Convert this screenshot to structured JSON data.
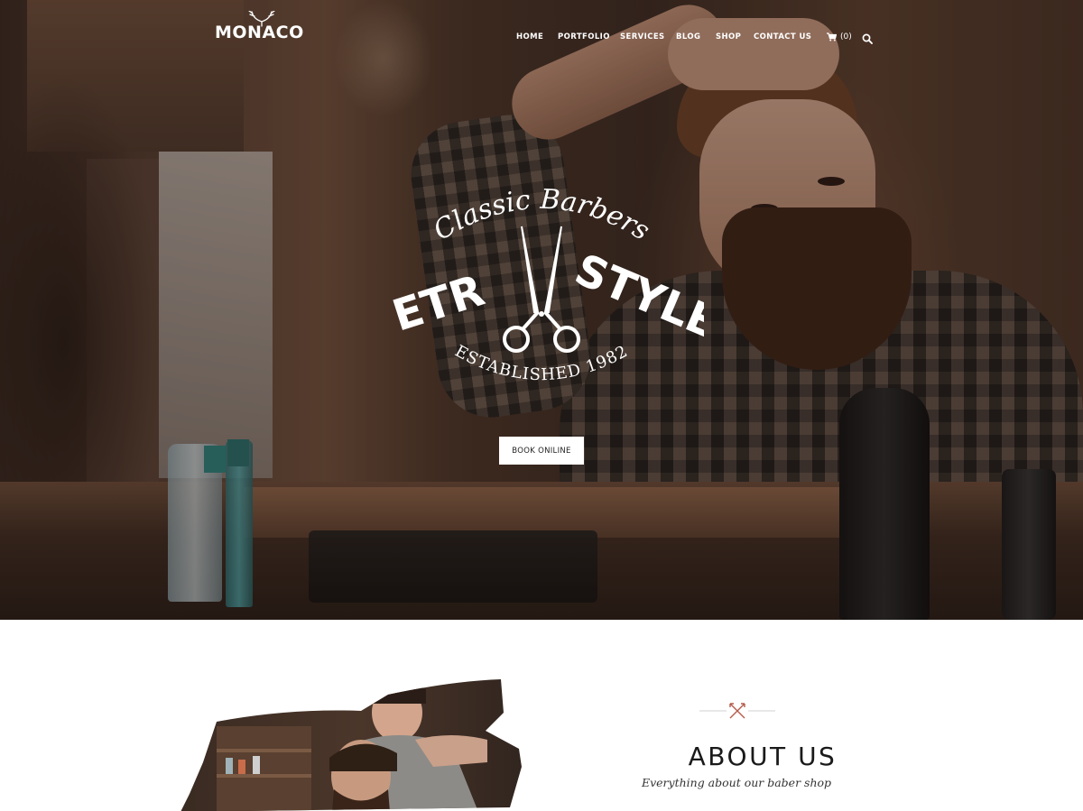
{
  "brand": {
    "logo_text": "MONACO"
  },
  "nav": {
    "items": [
      {
        "label": "HOME"
      },
      {
        "label": "PORTFOLIO"
      },
      {
        "label": "SERVICES"
      },
      {
        "label": "BLOG"
      },
      {
        "label": "SHOP"
      },
      {
        "label": "CONTACT US"
      }
    ],
    "cart_count": "(0)"
  },
  "hero": {
    "badge_top": "Classic Barbers",
    "badge_left": "RETRO",
    "badge_right": "STYLE",
    "badge_bottom": "- ESTABLISHED 1982 -",
    "cta_label": "BOOK ONILINE"
  },
  "about": {
    "title": "ABOUT US",
    "subtitle": "Everything about our baber shop"
  },
  "colors": {
    "accent": "#b55a4a",
    "text_dark": "#1a1a1a",
    "white": "#ffffff"
  },
  "icons": {
    "cart": "cart-icon",
    "search": "search-icon",
    "scissors": "scissors-icon",
    "antlers": "antlers-icon",
    "divider": "crossed-arrows-icon"
  }
}
